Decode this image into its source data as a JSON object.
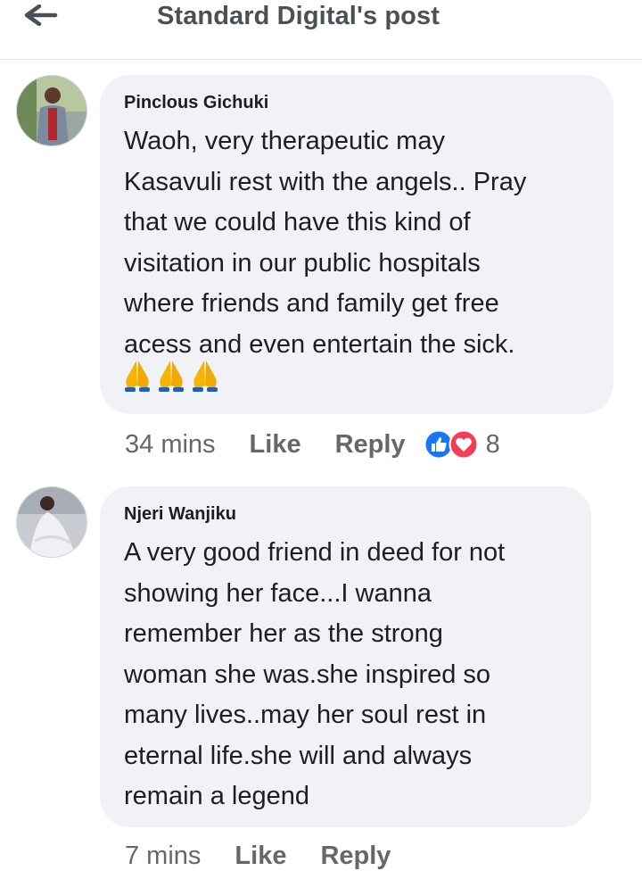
{
  "header": {
    "title": "Standard Digital's post",
    "back_icon": "arrow-left-icon"
  },
  "colors": {
    "like_blue": "#1877f2",
    "love_red": "#f33e58",
    "bubble_bg": "#f0f2f5",
    "meta_gray": "#65676b",
    "emoji_yellow": "#f4b400"
  },
  "comments": [
    {
      "author": "Pinclous Gichuki",
      "text": "Waoh, very therapeutic may\nKasavuli rest with the angels.. Pray\nthat we could have this kind of\nvisitation in our public hospitals\nwhere friends and family get free\nacess and even entertain the sick.",
      "emojis": [
        "🙏",
        "🙏",
        "🙏"
      ],
      "time": "34 mins",
      "like_label": "Like",
      "reply_label": "Reply",
      "reactions": [
        "like-icon",
        "love-icon"
      ],
      "reaction_count": "8"
    },
    {
      "author": "Njeri Wanjiku",
      "text": "A very good friend in deed for not\nshowing her face...I wanna\nremember her as the strong\nwoman she was.she inspired so\nmany lives..may her soul rest in\neternal life.she will and always\nremain a legend",
      "time": "7 mins",
      "like_label": "Like",
      "reply_label": "Reply"
    }
  ]
}
